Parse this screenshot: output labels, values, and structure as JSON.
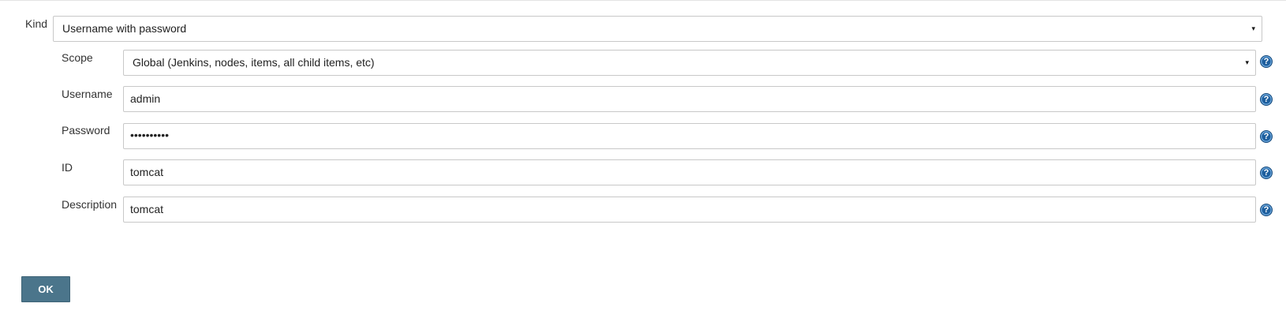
{
  "form": {
    "kind": {
      "label": "Kind",
      "value": "Username with password"
    },
    "scope": {
      "label": "Scope",
      "value": "Global (Jenkins, nodes, items, all child items, etc)"
    },
    "username": {
      "label": "Username",
      "value": "admin"
    },
    "password": {
      "label": "Password",
      "value": "••••••••••"
    },
    "id": {
      "label": "ID",
      "value": "tomcat"
    },
    "description": {
      "label": "Description",
      "value": "tomcat"
    }
  },
  "icons": {
    "dropdown": "▾",
    "help": "?"
  },
  "colors": {
    "ok_button_bg": "#4b758b",
    "help_icon": "#1e5f9e",
    "field_border": "#c8c8c8"
  },
  "actions": {
    "ok_label": "OK"
  }
}
